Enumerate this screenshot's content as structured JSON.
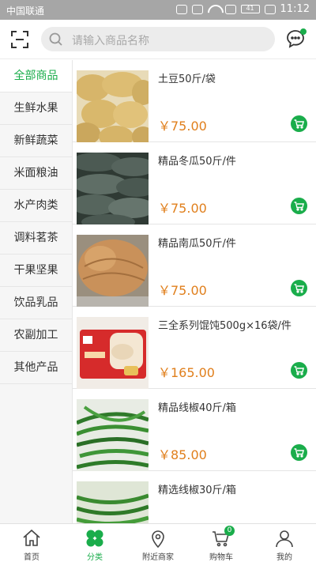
{
  "status_bar": {
    "carrier": "中国联通",
    "battery": "41",
    "time": "11:12"
  },
  "search": {
    "placeholder": "请输入商品名称"
  },
  "categories": [
    {
      "label": "全部商品",
      "active": true
    },
    {
      "label": "生鲜水果"
    },
    {
      "label": "新鲜蔬菜"
    },
    {
      "label": "米面粮油"
    },
    {
      "label": "水产肉类"
    },
    {
      "label": "调料茗茶"
    },
    {
      "label": "干果坚果"
    },
    {
      "label": "饮品乳品"
    },
    {
      "label": "农副加工"
    },
    {
      "label": "其他产品"
    }
  ],
  "products": [
    {
      "name": "土豆50斤/袋",
      "price": "￥75.00"
    },
    {
      "name": "精品冬瓜50斤/件",
      "price": "￥75.00"
    },
    {
      "name": "精品南瓜50斤/件",
      "price": "￥75.00"
    },
    {
      "name": "三全系列馄饨500g×16袋/件",
      "price": "￥165.00"
    },
    {
      "name": "精品线椒40斤/箱",
      "price": "￥85.00"
    },
    {
      "name": "精选线椒30斤/箱",
      "price": ""
    }
  ],
  "bottom_nav": [
    {
      "label": "首页",
      "icon": "home-icon"
    },
    {
      "label": "分类",
      "icon": "category-icon",
      "active": true
    },
    {
      "label": "附近商家",
      "icon": "location-icon"
    },
    {
      "label": "购物车",
      "icon": "cart-icon",
      "badge": "0"
    },
    {
      "label": "我的",
      "icon": "user-icon"
    }
  ],
  "colors": {
    "accent": "#1aad4b",
    "price": "#e07f1c",
    "status_bar": "#a6a6a6"
  }
}
